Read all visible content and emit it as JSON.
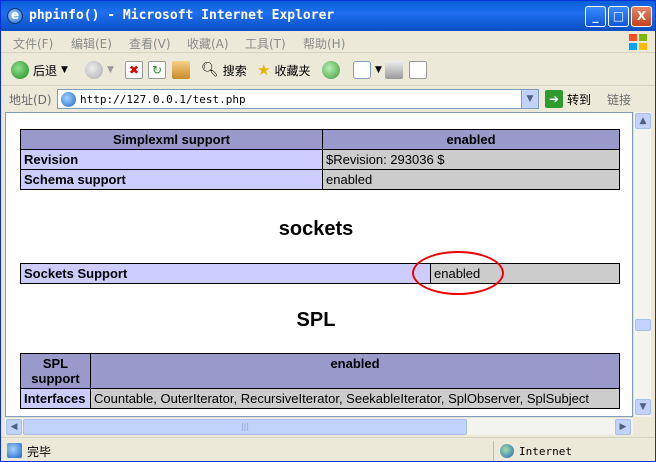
{
  "window": {
    "title": "phpinfo() - Microsoft Internet Explorer",
    "controls": [
      "_",
      "□",
      "X"
    ]
  },
  "menu": [
    "文件(F)",
    "编辑(E)",
    "查看(V)",
    "收藏(A)",
    "工具(T)",
    "帮助(H)"
  ],
  "toolbar": {
    "back": "后退",
    "search": "搜索",
    "favorites": "收藏夹"
  },
  "address": {
    "label": "地址(D)",
    "url": "http://127.0.0.1/test.php",
    "go": "转到",
    "links": "链接"
  },
  "page": {
    "simplexml": {
      "header": [
        "Simplexml support",
        "enabled"
      ],
      "rows": [
        [
          "Revision",
          "$Revision: 293036 $"
        ],
        [
          "Schema support",
          "enabled"
        ]
      ]
    },
    "sockets": {
      "heading": "sockets",
      "rows": [
        [
          "Sockets Support",
          "enabled"
        ]
      ]
    },
    "spl": {
      "heading": "SPL",
      "header": [
        "SPL support",
        "enabled"
      ],
      "rows": [
        [
          "Interfaces",
          "Countable, OuterIterator, RecursiveIterator, SeekableIterator, SplObserver, SplSubject"
        ]
      ]
    }
  },
  "status": {
    "text": "完毕",
    "zone": "Internet"
  }
}
